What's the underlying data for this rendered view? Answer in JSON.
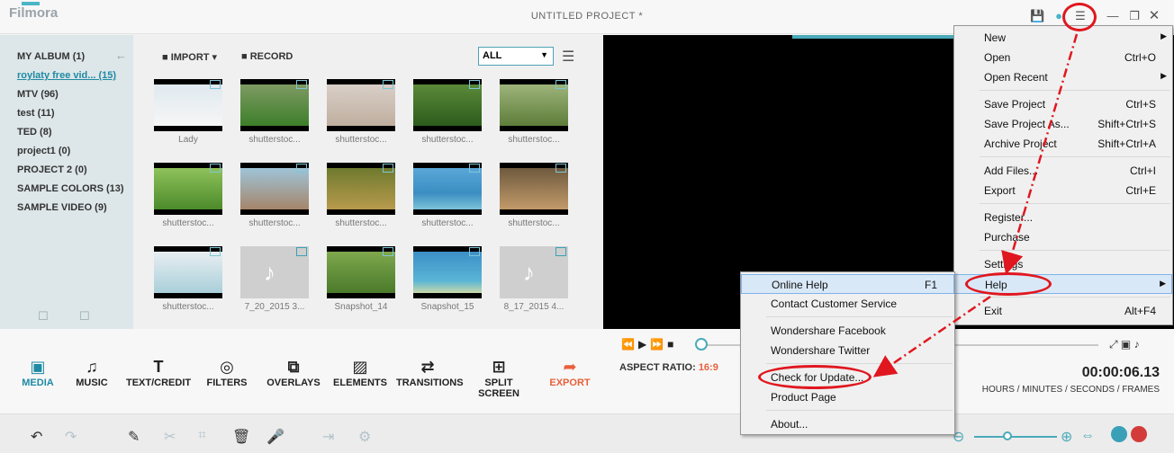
{
  "window": {
    "title": "UNTITLED PROJECT *",
    "logo": "Filmora"
  },
  "albums": [
    {
      "label": "MY ALBUM (1)"
    },
    {
      "label": "roylaty free vid... (15)"
    },
    {
      "label": "MTV (96)"
    },
    {
      "label": "test (11)"
    },
    {
      "label": "TED (8)"
    },
    {
      "label": "project1 (0)"
    },
    {
      "label": "PROJECT 2 (0)"
    },
    {
      "label": "SAMPLE COLORS (13)"
    },
    {
      "label": "SAMPLE VIDEO (9)"
    }
  ],
  "media_toolbar": {
    "import": "IMPORT",
    "record": "RECORD",
    "filter": "ALL"
  },
  "media": [
    "Lady",
    "shutterstoc...",
    "shutterstoc...",
    "shutterstoc...",
    "shutterstoc...",
    "shutterstoc...",
    "shutterstoc...",
    "shutterstoc...",
    "shutterstoc...",
    "shutterstoc...",
    "shutterstoc...",
    "7_20_2015 3...",
    "Snapshot_14",
    "Snapshot_15",
    "8_17_2015 4..."
  ],
  "tools": [
    "MEDIA",
    "MUSIC",
    "TEXT/CREDIT",
    "FILTERS",
    "OVERLAYS",
    "ELEMENTS",
    "TRANSITIONS",
    "SPLIT SCREEN",
    "EXPORT"
  ],
  "player": {
    "aspect_label": "ASPECT RATIO:",
    "aspect_value": "16:9",
    "time": "00:00:06.13",
    "time_units": "HOURS / MINUTES / SECONDS / FRAMES"
  },
  "main_menu": [
    {
      "label": "New",
      "shortcut": ""
    },
    {
      "label": "Open",
      "shortcut": "Ctrl+O"
    },
    {
      "label": "Open Recent",
      "shortcut": ""
    },
    {
      "label": "Save Project",
      "shortcut": "Ctrl+S"
    },
    {
      "label": "Save Project As...",
      "shortcut": "Shift+Ctrl+S"
    },
    {
      "label": "Archive Project",
      "shortcut": "Shift+Ctrl+A"
    },
    {
      "label": "Add Files...",
      "shortcut": "Ctrl+I"
    },
    {
      "label": "Export",
      "shortcut": "Ctrl+E"
    },
    {
      "label": "Register...",
      "shortcut": ""
    },
    {
      "label": "Purchase",
      "shortcut": ""
    },
    {
      "label": "Settings",
      "shortcut": ""
    },
    {
      "label": "Help",
      "shortcut": ""
    },
    {
      "label": "Exit",
      "shortcut": "Alt+F4"
    }
  ],
  "help_menu": [
    {
      "label": "Online Help",
      "shortcut": "F1"
    },
    {
      "label": "Contact Customer Service",
      "shortcut": ""
    },
    {
      "label": "Wondershare Facebook",
      "shortcut": ""
    },
    {
      "label": "Wondershare Twitter",
      "shortcut": ""
    },
    {
      "label": "Check for Update...",
      "shortcut": ""
    },
    {
      "label": "Product Page",
      "shortcut": ""
    },
    {
      "label": "About...",
      "shortcut": ""
    }
  ],
  "colors": {
    "accent": "#1f8aa3",
    "export": "#e8603c",
    "annotation": "#e0171f"
  }
}
